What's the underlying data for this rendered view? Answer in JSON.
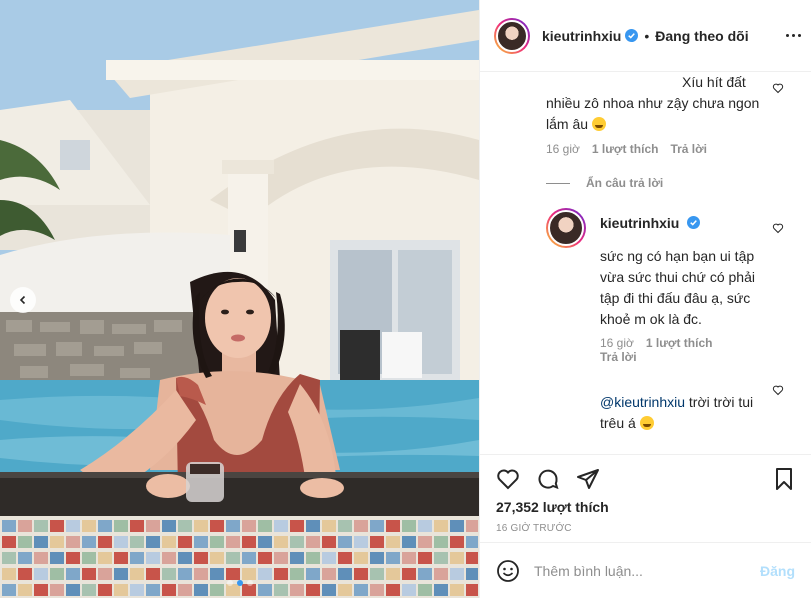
{
  "header": {
    "username": "kieutrinhxiu",
    "separator": "•",
    "follow_state": "Đang theo dõi"
  },
  "comments": {
    "first": {
      "text_line1": "Xíu hít đất",
      "text_line2": "nhiều zô nhoa như zậy chưa ngon",
      "text_line3": "lắm âu",
      "age": "16 giờ",
      "likes": "1 lượt thích",
      "reply": "Trả lời"
    },
    "hide_replies": "Ẩn câu trả lời",
    "reply1": {
      "username": "kieutrinhxiu",
      "line1": "sức ng có hạn bạn ui tập",
      "line2": "vừa sức thui chứ có phải",
      "line3": "tập đi thi đấu đâu ạ, sức",
      "line4": "khoẻ m ok là đc.",
      "age": "16 giờ",
      "likes": "1 lượt thích",
      "reply": "Trả lời"
    },
    "reply2": {
      "mention": "@kieutrinhxiu",
      "line1_rest": " trời trời tui",
      "line2": "trêu á"
    }
  },
  "stats": {
    "likes": "27,352 lượt thích",
    "time": "16 GIỜ TRƯỚC"
  },
  "composer": {
    "placeholder": "Thêm bình luận...",
    "post_label": "Đăng"
  },
  "carousel": {
    "slides": 3,
    "active_index": 1
  },
  "colors": {
    "verified_blue": "#3897f0",
    "link_blue": "#00376b",
    "post_disabled": "#b2dffc",
    "secondary_text": "#8e8e8e"
  }
}
